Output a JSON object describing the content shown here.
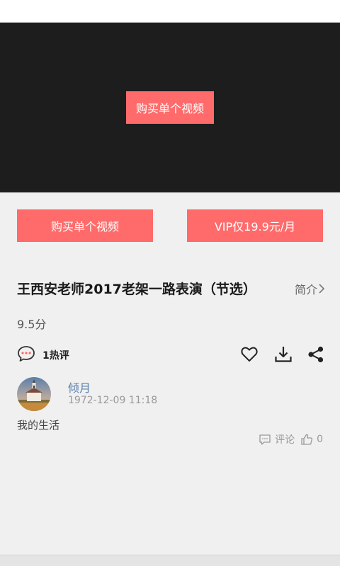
{
  "player": {
    "buy_single_label": "购买单个视频"
  },
  "purchase": {
    "buy_single_label": "购买单个视频",
    "vip_label": "VIP仅19.9元/月"
  },
  "video_info": {
    "title": "王西安老师2017老架一路表演（节选）",
    "intro_label": "简介",
    "score": "9.5分"
  },
  "actions": {
    "hot_comments_label": "1热评",
    "icons": [
      "comment-bubble-icon",
      "heart-icon",
      "download-icon",
      "share-icon"
    ]
  },
  "comment": {
    "username": "倾月",
    "time": "1972-12-09 11:18",
    "content": "我的生活",
    "reply_label": "评论",
    "like_count": "0"
  },
  "colors": {
    "accent": "#ff6b6b",
    "video_bg": "#1d1d1d",
    "username": "#5a7fad"
  }
}
